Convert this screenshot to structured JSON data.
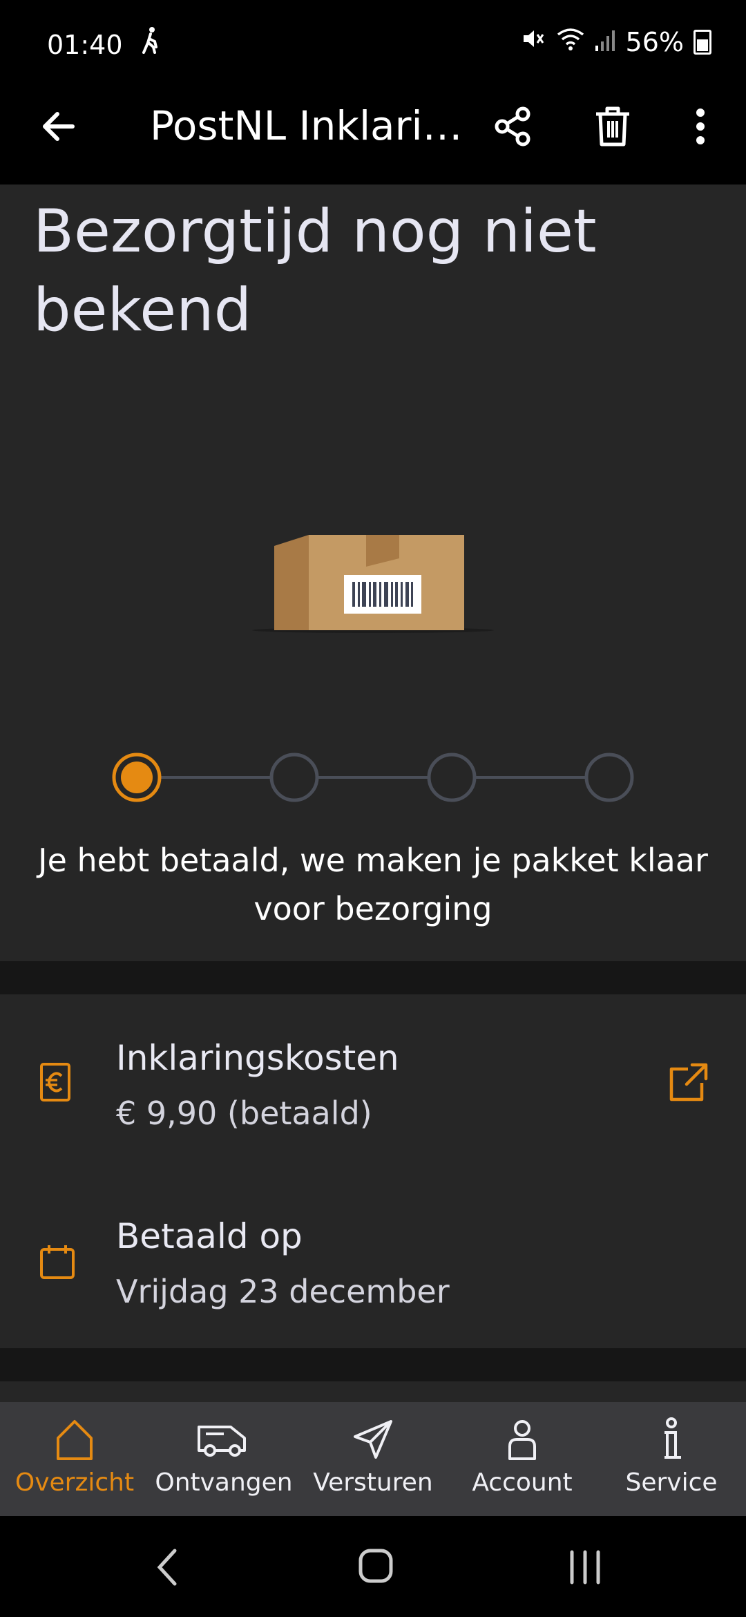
{
  "status_bar": {
    "time": "01:40",
    "battery": "56%"
  },
  "app_bar": {
    "title": "PostNL Inklari…"
  },
  "shipment": {
    "headline": "Bezorgtijd nog niet bekend",
    "steps_total": 4,
    "step_current": 1,
    "status_message": "Je hebt betaald, we maken je pakket klaar voor bezorging"
  },
  "details": [
    {
      "title": "Inklaringskosten",
      "value": "€ 9,90 (betaald)"
    },
    {
      "title": "Betaald op",
      "value": "Vrijdag 23 december"
    }
  ],
  "bottom_nav": {
    "items": [
      {
        "label": "Overzicht",
        "icon": "home-icon"
      },
      {
        "label": "Ontvangen",
        "icon": "van-icon"
      },
      {
        "label": "Versturen",
        "icon": "send-icon"
      },
      {
        "label": "Account",
        "icon": "account-icon"
      },
      {
        "label": "Service",
        "icon": "info-icon"
      }
    ],
    "active_index": 0
  },
  "colors": {
    "accent": "#E58A12",
    "background": "#262626",
    "nav_background": "#3A3A3D"
  }
}
